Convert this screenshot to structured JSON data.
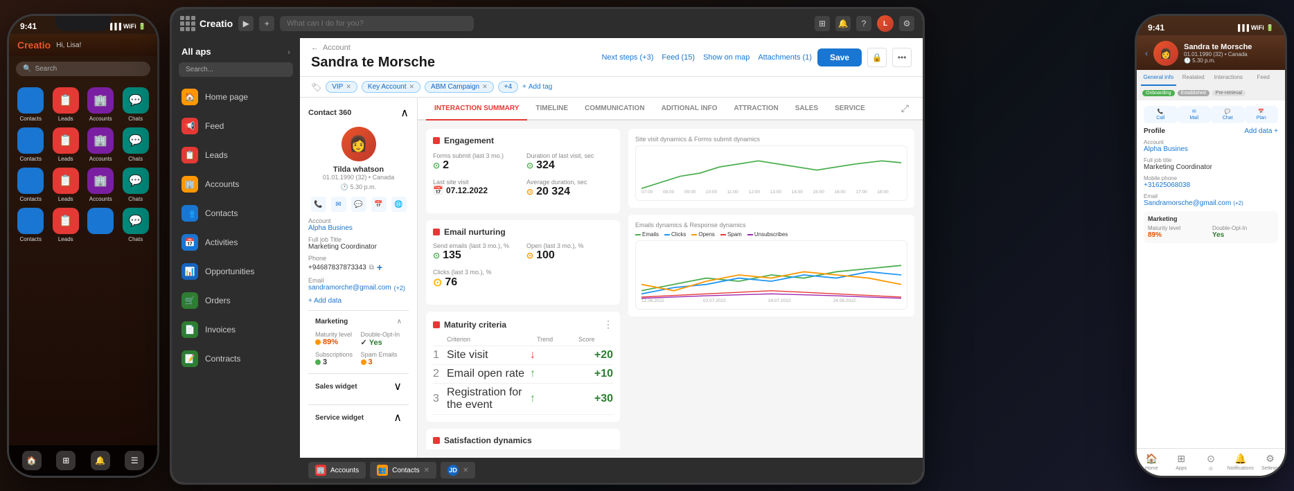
{
  "app": {
    "name": "Creatio",
    "search_placeholder": "What can I do for you?",
    "top_icons": [
      "grid",
      "bell",
      "question",
      "avatar",
      "settings"
    ]
  },
  "left_phone": {
    "time": "9:41",
    "greeting": "Hi, Lisa!",
    "app_name": "Creatio",
    "apps": [
      {
        "label": "Contacts",
        "color": "#1976d2",
        "icon": "👤"
      },
      {
        "label": "Leads",
        "color": "#e53935",
        "icon": "📋"
      },
      {
        "label": "Accounts",
        "color": "#7b1fa2",
        "icon": "🏢"
      },
      {
        "label": "Chats",
        "color": "#00897b",
        "icon": "💬"
      },
      {
        "label": "Contacts",
        "color": "#1976d2",
        "icon": "👤"
      },
      {
        "label": "Leads",
        "color": "#e53935",
        "icon": "📋"
      },
      {
        "label": "Accounts",
        "color": "#7b1fa2",
        "icon": "🏢"
      },
      {
        "label": "Chats",
        "color": "#00897b",
        "icon": "💬"
      },
      {
        "label": "Contacts",
        "color": "#1976d2",
        "icon": "👤"
      },
      {
        "label": "Leads",
        "color": "#e53935",
        "icon": "📋"
      },
      {
        "label": "Accounts",
        "color": "#7b1fa2",
        "icon": "🏢"
      },
      {
        "label": "Chats",
        "color": "#00897b",
        "icon": "💬"
      },
      {
        "label": "Contacts",
        "color": "#1976d2",
        "icon": "👤"
      },
      {
        "label": "Leads",
        "color": "#e53935",
        "icon": "📋"
      },
      {
        "label": "",
        "color": "#1976d2",
        "icon": "👤"
      },
      {
        "label": "Chats",
        "color": "#00897b",
        "icon": "💬"
      }
    ]
  },
  "sidebar": {
    "title": "All aps",
    "search_placeholder": "Search...",
    "items": [
      {
        "label": "Home page",
        "icon": "🏠",
        "color": "#ff9800"
      },
      {
        "label": "Feed",
        "icon": "📢",
        "color": "#e53935"
      },
      {
        "label": "Leads",
        "icon": "📋",
        "color": "#e53935"
      },
      {
        "label": "Accounts",
        "icon": "🏢",
        "color": "#ff9800"
      },
      {
        "label": "Contacts",
        "icon": "👥",
        "color": "#1976d2"
      },
      {
        "label": "Activities",
        "icon": "📅",
        "color": "#1976d2"
      },
      {
        "label": "Opportunities",
        "icon": "📊",
        "color": "#1565c0"
      },
      {
        "label": "Orders",
        "icon": "🛒",
        "color": "#2e7d32"
      },
      {
        "label": "Invoices",
        "icon": "📄",
        "color": "#2e7d32"
      },
      {
        "label": "Contracts",
        "icon": "📝",
        "color": "#2e7d32"
      }
    ]
  },
  "breadcrumb": {
    "parent": "Account",
    "current": "Sandra te Morsche"
  },
  "header": {
    "title": "Sandra te Morsche",
    "save_label": "Save",
    "next_steps": "Next steps (+3)",
    "feed": "Feed (15)",
    "show_on_map": "Show on map",
    "attachments": "Attachments (1)"
  },
  "tags": [
    {
      "label": "VIP"
    },
    {
      "label": "Key Account"
    },
    {
      "label": "ABM Campaign"
    },
    {
      "label": "+4"
    },
    {
      "label": "Add tag"
    }
  ],
  "contact_360": {
    "title": "Contact 360",
    "name": "Tilda whatson",
    "date": "01.01.1990 (32) • Canada",
    "time": "5.30 p.m.",
    "actions": [
      "Call",
      "Mail",
      "Chat",
      "Plan",
      "Net..."
    ],
    "account_label": "Account",
    "account_value": "Alpha Busines",
    "job_title_label": "Full job Title",
    "job_title_value": "Marketing Coordinator",
    "phone_label": "Phone",
    "phone_value": "+94687837873343",
    "email_label": "Email",
    "email_value": "sandramorche@gmail.com",
    "email_extra": "(+2)",
    "add_data": "+ Add data"
  },
  "marketing": {
    "title": "Marketing",
    "maturity_label": "Maturity level",
    "maturity_value": "89%",
    "double_opt_label": "Double-Opt-In",
    "double_opt_value": "Yes",
    "subscriptions_label": "Subscriptions",
    "subscriptions_value": "3",
    "spam_label": "Spam Emails",
    "spam_value": "3"
  },
  "widgets": {
    "sales_label": "Sales widget",
    "service_label": "Service widget"
  },
  "tabs": [
    {
      "label": "INTERACTION SUMMARY",
      "active": true
    },
    {
      "label": "TIMELINE"
    },
    {
      "label": "COMMUNICATION"
    },
    {
      "label": "ADITIONAL INFO"
    },
    {
      "label": "ATTRACTION"
    },
    {
      "label": "SALES"
    },
    {
      "label": "SERVICE"
    }
  ],
  "engagement": {
    "title": "Engagement",
    "forms_submit_label": "Forms submit (last 3 mo.)",
    "forms_submit_value": "2",
    "last_site_visit_label": "Last site visit",
    "last_site_visit_value": "07.12.2022",
    "duration_label": "Duration of last visit, sec",
    "duration_value": "324",
    "avg_duration_label": "Average duration, sec",
    "avg_duration_value": "20 324",
    "chart_label": "Site visit dynamics & Forms submit dynamics",
    "x_labels": [
      "07:00",
      "08:00",
      "09:00",
      "10:00",
      "11:00",
      "12:00",
      "13:00",
      "14:00",
      "15:00",
      "16:00",
      "17:00",
      "18:00"
    ]
  },
  "email_nurturing": {
    "title": "Email nurturing",
    "send_label": "Send emails (last 3 mo.), %",
    "send_value": "135",
    "open_label": "Open (last 3 mo.), %",
    "open_value": "100",
    "clicks_label": "Clicks (last 3 mo.), %",
    "clicks_value": "76",
    "chart_label": "Emails dynamics & Response dynamics",
    "legend": [
      "Emails",
      "Clicks",
      "Opens",
      "Spam",
      "Unsubscribes"
    ],
    "x_labels": [
      "12.06.2022",
      "02.07.2022",
      "24.07.2022",
      "24.08.2022"
    ]
  },
  "maturity_criteria": {
    "title": "Maturity criteria",
    "criteria": [
      {
        "num": "1",
        "name": "Site visit",
        "trend": "down",
        "score": "+20"
      },
      {
        "num": "2",
        "name": "Email open rate",
        "trend": "up",
        "score": "+10"
      },
      {
        "num": "3",
        "name": "Registration for the event",
        "trend": "up",
        "score": "+30"
      }
    ]
  },
  "satisfaction": {
    "title": "Satisfaction dynamics"
  },
  "taskbar": [
    {
      "label": "Accounts",
      "icon": "🏢",
      "color": "#e53935"
    },
    {
      "label": "Contacts",
      "icon": "👥",
      "color": "#ff9800"
    },
    {
      "label": "JD",
      "color": "#1565c0"
    }
  ],
  "right_phone": {
    "time": "9:41",
    "name": "Sandra te Morsche",
    "meta": "01.01.1990 (32) • Canada",
    "time_label": "5.30 p.m.",
    "tabs": [
      "General info",
      "Realated",
      "Interactions",
      "Feed"
    ],
    "badges": [
      "Onboarding",
      "Established",
      "Pre-retrieval"
    ],
    "account_label": "Account",
    "account_value": "Alpha Busines",
    "job_label": "Full job title",
    "job_value": "Marketing Coordinator",
    "phone_label": "Mobile phone",
    "phone_value": "+31625068038",
    "email_label": "Email",
    "email_value": "Sandramorsche@gmail.com",
    "email_extra": "(+2)",
    "marketing_title": "Marketing",
    "maturity_label": "Maturity level",
    "maturity_value": "89%",
    "double_opt_label": "Double-Opt-In",
    "double_opt_value": "Yes",
    "nav_items": [
      "Home",
      "Apps",
      "⊙",
      "Notifications",
      "Settings"
    ]
  }
}
